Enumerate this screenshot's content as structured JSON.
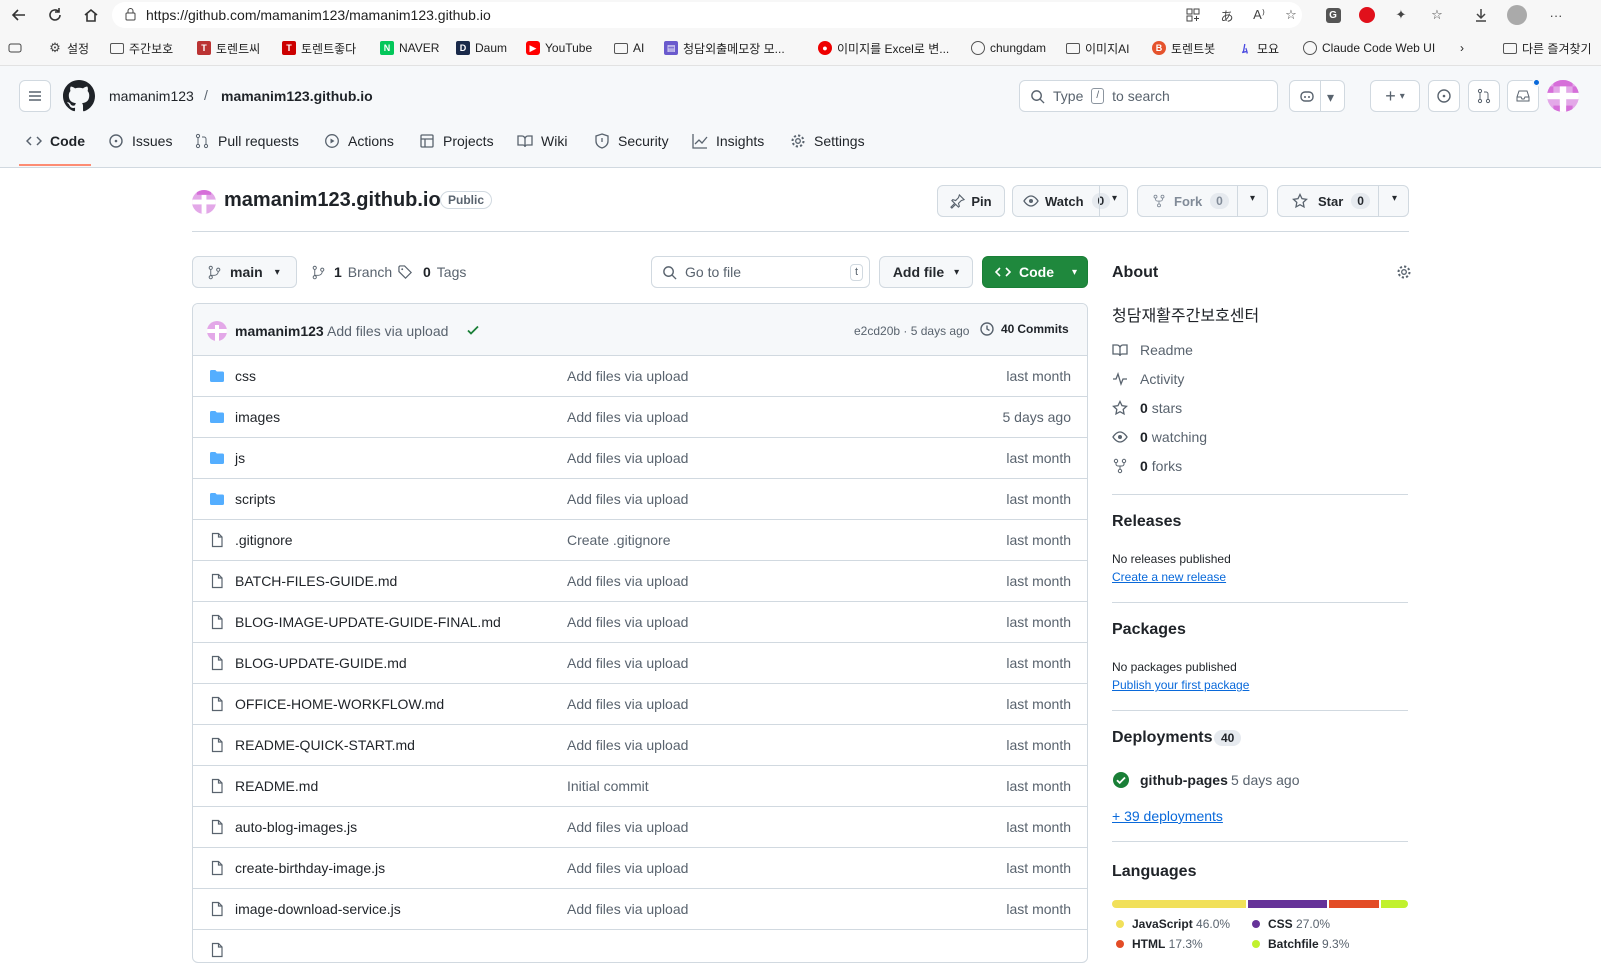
{
  "browser": {
    "url": "https://github.com/mamanim123/mamanim123.github.io",
    "bookmarks": [
      "설정",
      "주간보호",
      "토렌트씨",
      "토렌트좋다",
      "NAVER",
      "Daum",
      "YouTube",
      "AI",
      "청담외출메모장 모...",
      "이미지를 Excel로 변...",
      "chungdam",
      "이미지AI",
      "토렌트봇",
      "모요",
      "Claude Code Web UI",
      "다른 즐겨찾기"
    ]
  },
  "header": {
    "owner": "mamanim123",
    "separator": "/",
    "repo": "mamanim123.github.io",
    "search_placeholder": "Type",
    "search_key": "/",
    "search_suffix": "to search"
  },
  "tabs": [
    "Code",
    "Issues",
    "Pull requests",
    "Actions",
    "Projects",
    "Wiki",
    "Security",
    "Insights",
    "Settings"
  ],
  "repo": {
    "title": "mamanim123.github.io",
    "visibility": "Public",
    "pin": "Pin",
    "watch": "Watch",
    "watch_count": "0",
    "fork": "Fork",
    "fork_count": "0",
    "star": "Star",
    "star_count": "0"
  },
  "toolbar": {
    "branch": "main",
    "branches_count": "1",
    "branches_label": "Branch",
    "tags_count": "0",
    "tags_label": "Tags",
    "goto_placeholder": "Go to file",
    "goto_key": "t",
    "add_file": "Add file",
    "code": "Code"
  },
  "commit": {
    "author": "mamanim123",
    "message": "Add files via upload",
    "sha_time": "e2cd20b · 5 days ago",
    "commits_count": "40",
    "commits_label": "Commits"
  },
  "files": [
    {
      "name": "css",
      "type": "dir",
      "message": "Add files via upload",
      "age": "last month"
    },
    {
      "name": "images",
      "type": "dir",
      "message": "Add files via upload",
      "age": "5 days ago"
    },
    {
      "name": "js",
      "type": "dir",
      "message": "Add files via upload",
      "age": "last month"
    },
    {
      "name": "scripts",
      "type": "dir",
      "message": "Add files via upload",
      "age": "last month"
    },
    {
      "name": ".gitignore",
      "type": "file",
      "message": "Create .gitignore",
      "age": "last month"
    },
    {
      "name": "BATCH-FILES-GUIDE.md",
      "type": "file",
      "message": "Add files via upload",
      "age": "last month"
    },
    {
      "name": "BLOG-IMAGE-UPDATE-GUIDE-FINAL.md",
      "type": "file",
      "message": "Add files via upload",
      "age": "last month"
    },
    {
      "name": "BLOG-UPDATE-GUIDE.md",
      "type": "file",
      "message": "Add files via upload",
      "age": "last month"
    },
    {
      "name": "OFFICE-HOME-WORKFLOW.md",
      "type": "file",
      "message": "Add files via upload",
      "age": "last month"
    },
    {
      "name": "README-QUICK-START.md",
      "type": "file",
      "message": "Add files via upload",
      "age": "last month"
    },
    {
      "name": "README.md",
      "type": "file",
      "message": "Initial commit",
      "age": "last month"
    },
    {
      "name": "auto-blog-images.js",
      "type": "file",
      "message": "Add files via upload",
      "age": "last month"
    },
    {
      "name": "create-birthday-image.js",
      "type": "file",
      "message": "Add files via upload",
      "age": "last month"
    },
    {
      "name": "image-download-service.js",
      "type": "file",
      "message": "Add files via upload",
      "age": "last month"
    }
  ],
  "about": {
    "heading": "About",
    "description": "청담재활주간보호센터",
    "readme": "Readme",
    "activity": "Activity",
    "stars_count": "0",
    "stars_label": "stars",
    "watching_count": "0",
    "watching_label": "watching",
    "forks_count": "0",
    "forks_label": "forks"
  },
  "releases": {
    "heading": "Releases",
    "none": "No releases published",
    "create": "Create a new release"
  },
  "packages": {
    "heading": "Packages",
    "none": "No packages published",
    "publish": "Publish your first package"
  },
  "deployments": {
    "heading": "Deployments",
    "count": "40",
    "env": "github-pages",
    "time": "5 days ago",
    "more": "+ 39 deployments"
  },
  "languages": {
    "heading": "Languages",
    "items": [
      {
        "name": "JavaScript",
        "pct": "46.0%",
        "value": 46.0,
        "color": "#f1e05a"
      },
      {
        "name": "CSS",
        "pct": "27.0%",
        "value": 27.0,
        "color": "#663399"
      },
      {
        "name": "HTML",
        "pct": "17.3%",
        "value": 17.3,
        "color": "#e34c26"
      },
      {
        "name": "Batchfile",
        "pct": "9.3%",
        "value": 9.3,
        "color": "#c1f12e"
      }
    ]
  }
}
